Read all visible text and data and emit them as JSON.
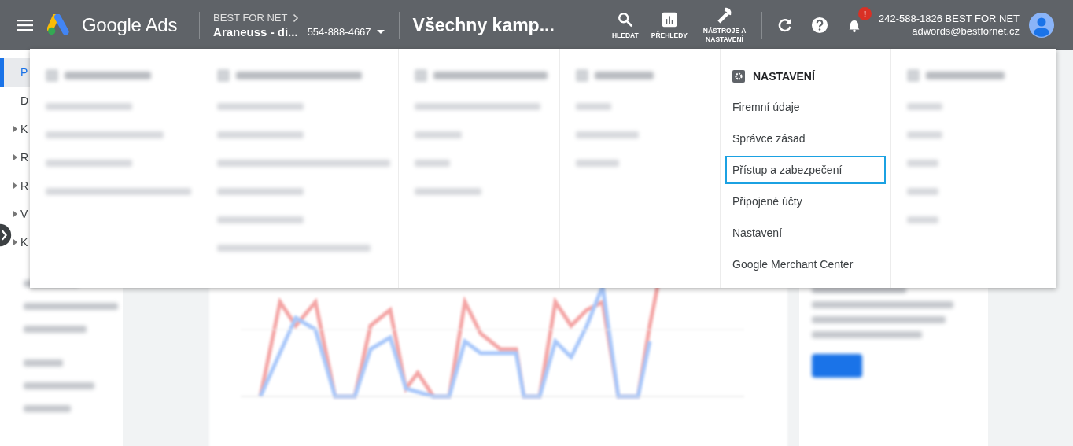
{
  "header": {
    "logo_text": "Google Ads",
    "account_parent": "BEST FOR NET",
    "account_name": "Araneuss - di...",
    "account_id": "554-888-4667",
    "page_title": "Všechny kamp...",
    "tools": [
      {
        "kind": "search",
        "label": "HLEDAT"
      },
      {
        "kind": "reports",
        "label": "PŘEHLEDY"
      },
      {
        "kind": "tools",
        "label": "NÁSTROJE A NASTAVENÍ"
      }
    ],
    "notification_badge": "!",
    "user_line": "242-588-1826 BEST FOR NET",
    "user_email": "adwords@bestfornet.cz"
  },
  "sidebar": {
    "items": [
      {
        "label": "P",
        "selected": true,
        "expandable": false
      },
      {
        "label": "D",
        "selected": false,
        "expandable": false
      },
      {
        "label": "K",
        "selected": false,
        "expandable": true
      },
      {
        "label": "R",
        "selected": false,
        "expandable": true
      },
      {
        "label": "R",
        "selected": false,
        "expandable": true
      },
      {
        "label": "V",
        "selected": false,
        "expandable": true
      },
      {
        "label": "K",
        "selected": false,
        "expandable": true
      }
    ]
  },
  "menu": {
    "columns": [
      {
        "kind": "blurred",
        "items": [
          {
            "kind": "blurred"
          },
          {
            "kind": "blurred"
          },
          {
            "kind": "blurred"
          },
          {
            "kind": "blurred"
          }
        ]
      },
      {
        "kind": "blurred",
        "items": [
          {
            "kind": "blurred"
          },
          {
            "kind": "blurred"
          },
          {
            "kind": "blurred"
          },
          {
            "kind": "blurred"
          },
          {
            "kind": "blurred"
          },
          {
            "kind": "blurred"
          }
        ]
      },
      {
        "kind": "blurred",
        "items": [
          {
            "kind": "blurred"
          },
          {
            "kind": "blurred"
          },
          {
            "kind": "blurred"
          },
          {
            "kind": "blurred"
          }
        ]
      },
      {
        "kind": "blurred",
        "items": [
          {
            "kind": "blurred"
          },
          {
            "kind": "blurred"
          },
          {
            "kind": "blurred"
          }
        ]
      },
      {
        "kind": "text",
        "title": "NASTAVENÍ",
        "items": [
          {
            "label": "Firemní údaje",
            "selected": false
          },
          {
            "label": "Správce zásad",
            "selected": false
          },
          {
            "label": "Přístup a zabezpečení",
            "selected": true
          },
          {
            "label": "Připojené účty",
            "selected": false
          },
          {
            "label": "Nastavení",
            "selected": false
          },
          {
            "label": "Google Merchant Center",
            "selected": false
          }
        ]
      },
      {
        "kind": "blurred",
        "items": [
          {
            "kind": "blurred"
          },
          {
            "kind": "blurred"
          },
          {
            "kind": "blurred"
          },
          {
            "kind": "blurred"
          },
          {
            "kind": "blurred"
          }
        ]
      }
    ]
  }
}
